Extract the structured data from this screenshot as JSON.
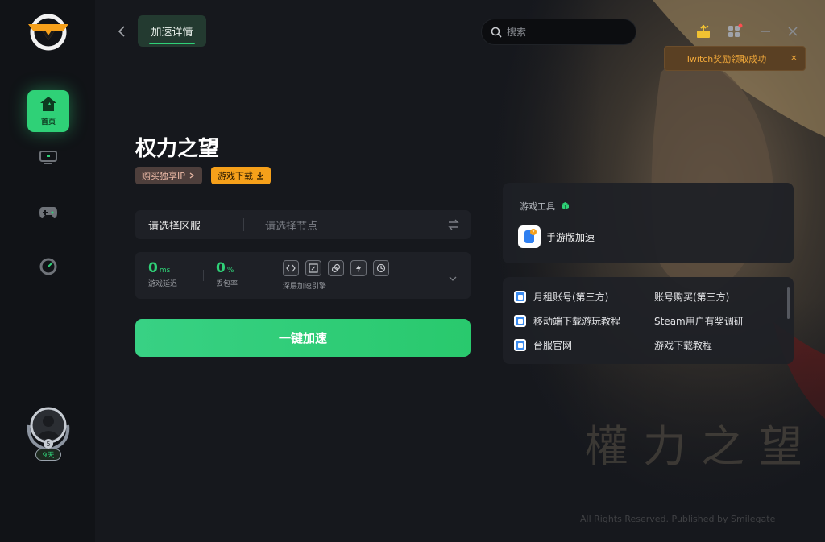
{
  "sidebar": {
    "home_label": "首页",
    "avatar_badge": "9天",
    "avatar_level": "5"
  },
  "header": {
    "tab_label": "加速详情",
    "search_placeholder": "搜索",
    "toast_text": "Twitch奖励领取成功",
    "toast_close": "×"
  },
  "game": {
    "title": "权力之望",
    "buy_ip_label": "购买独享IP",
    "download_label": "游戏下载"
  },
  "region": {
    "select_label": "请选择区服",
    "node_placeholder": "请选择节点"
  },
  "stats": {
    "latency_value": "0",
    "latency_unit": "ms",
    "latency_label": "游戏延迟",
    "loss_value": "0",
    "loss_unit": "%",
    "loss_label": "丢包率",
    "engine_label": "深层加速引擎"
  },
  "accelerate_label": "一键加速",
  "tools": {
    "title": "游戏工具",
    "mobile_label": "手游版加速"
  },
  "links": [
    {
      "label": "月租账号(第三方)"
    },
    {
      "label": "账号购买(第三方)"
    },
    {
      "label": "移动端下载游玩教程"
    },
    {
      "label": "Steam用户有奖调研"
    },
    {
      "label": "台服官网"
    },
    {
      "label": "游戏下载教程"
    }
  ],
  "background": {
    "watermark": "權力之望",
    "copyright": "All Rights Reserved. Published by Smilegate"
  },
  "colors": {
    "accent": "#2fd177",
    "download_tag": "#f6a01a",
    "toast_text": "#f1a83a"
  }
}
